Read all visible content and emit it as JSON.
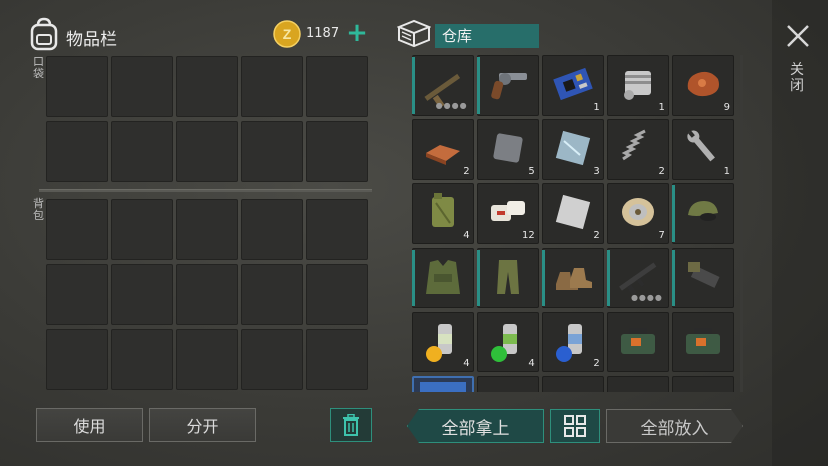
{
  "inventory": {
    "title": "物品栏",
    "coins": "1187",
    "add_icon": "plus-icon",
    "pocket_label": "口袋",
    "backpack_label": "背包",
    "pocket_slots": 10,
    "backpack_slots": 15
  },
  "actions": {
    "use": "使用",
    "split": "分开",
    "trash_icon": "trash-icon"
  },
  "storage": {
    "tab_label": "仓库",
    "items": [
      {
        "name": "assault-rifle",
        "count": "",
        "durability": true,
        "teal": true
      },
      {
        "name": "revolver",
        "count": "",
        "durability": false,
        "teal": true
      },
      {
        "name": "circuit-board",
        "count": "1",
        "durability": false,
        "teal": false
      },
      {
        "name": "engine-cylinder",
        "count": "1",
        "durability": false,
        "teal": false
      },
      {
        "name": "ore",
        "count": "9",
        "durability": false,
        "teal": false
      },
      {
        "name": "copper-ingot",
        "count": "2",
        "durability": false,
        "teal": false
      },
      {
        "name": "iron-plate",
        "count": "5",
        "durability": false,
        "teal": false
      },
      {
        "name": "glass-sheet",
        "count": "3",
        "durability": false,
        "teal": false
      },
      {
        "name": "spring",
        "count": "2",
        "durability": false,
        "teal": false
      },
      {
        "name": "wrench",
        "count": "1",
        "durability": false,
        "teal": false
      },
      {
        "name": "jerry-can",
        "count": "4",
        "durability": false,
        "teal": false
      },
      {
        "name": "bandage",
        "count": "12",
        "durability": false,
        "teal": false
      },
      {
        "name": "metal-sheet",
        "count": "2",
        "durability": false,
        "teal": false
      },
      {
        "name": "wire-spool",
        "count": "7",
        "durability": false,
        "teal": false
      },
      {
        "name": "military-cap",
        "count": "",
        "durability": false,
        "teal": true
      },
      {
        "name": "camo-vest",
        "count": "",
        "durability": false,
        "teal": true
      },
      {
        "name": "camo-pants",
        "count": "",
        "durability": false,
        "teal": true
      },
      {
        "name": "boots",
        "count": "",
        "durability": false,
        "teal": true
      },
      {
        "name": "rifle",
        "count": "",
        "durability": true,
        "teal": true
      },
      {
        "name": "weapon-part",
        "count": "",
        "durability": false,
        "teal": true
      },
      {
        "name": "spray-can-yellow",
        "count": "4",
        "durability": false,
        "teal": false
      },
      {
        "name": "spray-can-green",
        "count": "4",
        "durability": false,
        "teal": false
      },
      {
        "name": "spray-can-blue",
        "count": "2",
        "durability": false,
        "teal": false
      },
      {
        "name": "explosive-pack",
        "count": "",
        "durability": false,
        "teal": false
      },
      {
        "name": "explosive-pack",
        "count": "",
        "durability": false,
        "teal": false
      },
      {
        "name": "selected-item",
        "count": "",
        "durability": false,
        "teal": false,
        "selected": true
      },
      {
        "name": "empty",
        "count": "",
        "durability": false,
        "teal": false
      },
      {
        "name": "empty",
        "count": "",
        "durability": false,
        "teal": false
      },
      {
        "name": "empty",
        "count": "",
        "durability": false,
        "teal": false
      },
      {
        "name": "empty",
        "count": "",
        "durability": false,
        "teal": false
      }
    ]
  },
  "bottom": {
    "take_all": "全部拿上",
    "sort_icon": "grid-sort-icon",
    "put_all": "全部放入"
  },
  "close": {
    "icon": "close-icon",
    "label": "关闭"
  },
  "colors": {
    "accent": "#2a8f86",
    "add": "#2fb89a",
    "coin": "#d9a520"
  }
}
